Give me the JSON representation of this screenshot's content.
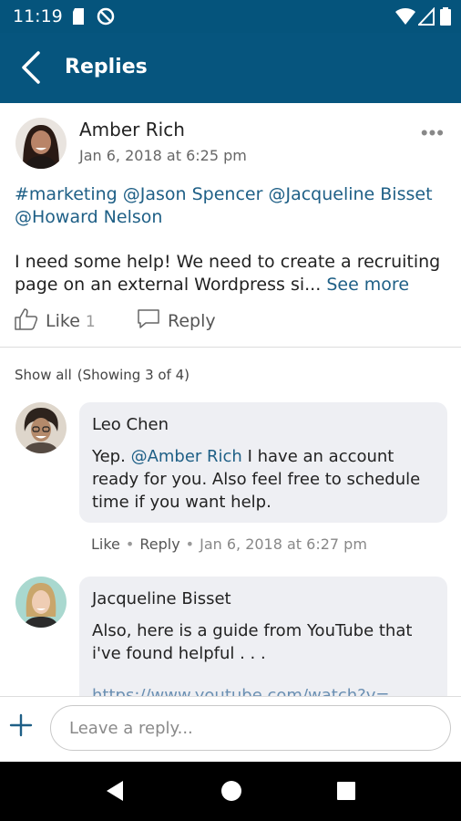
{
  "status_bar": {
    "time": "11:19",
    "icons": [
      "sd-card-icon",
      "do-not-disturb-icon",
      "wifi-icon",
      "cell-signal-icon",
      "battery-icon"
    ]
  },
  "app_bar": {
    "title": "Replies",
    "back_icon": "chevron-left-icon"
  },
  "post": {
    "author": "Amber Rich",
    "time": "Jan 6, 2018 at 6:25 pm",
    "mentions_line1": "#marketing @Jason Spencer @Jacqueline Bisset",
    "mentions_line2": "@Howard Nelson",
    "body_line1": "I need some help! We need to create a recruiting",
    "body_line2": "page on an external Wordpress si...",
    "see_more": "See more",
    "like_label": "Like",
    "like_count": "1",
    "reply_label": "Reply"
  },
  "replies_header": {
    "show_all": "Show all",
    "showing": "(Showing 3 of 4)"
  },
  "replies": [
    {
      "name": "Leo Chen",
      "mention": "@Amber Rich",
      "text_after_mention": " I have an account ready for you.  Also feel free to schedule time if you want help.",
      "text_prefix": "Yep. ",
      "like": "Like",
      "reply": "Reply",
      "time": "Jan 6, 2018 at 6:27 pm"
    },
    {
      "name": "Jacqueline Bisset",
      "text": "Also, here is a guide from YouTube that i've found helpful . . .",
      "link": "https://www.youtube.com/watch?v="
    }
  ],
  "composer": {
    "placeholder": "Leave a reply...",
    "add_icon": "plus-icon"
  },
  "nav_bar": {
    "back": "triangle-back-icon",
    "home": "circle-home-icon",
    "recents": "square-recents-icon"
  },
  "colors": {
    "brand": "#06557e",
    "link": "#1e5f86",
    "bubble": "#eeeff3"
  }
}
